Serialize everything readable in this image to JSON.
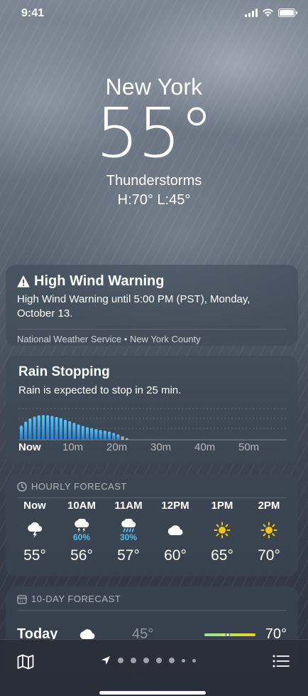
{
  "status_bar": {
    "time": "9:41"
  },
  "location": {
    "city": "New York",
    "temperature": "55°",
    "condition": "Thunderstorms",
    "high_low": "H:70°  L:45°"
  },
  "alert": {
    "title": "High Wind Warning",
    "body": "High Wind Warning until 5:00 PM (PST), Monday, October 13.",
    "source": "National Weather Service • New York County",
    "icon": "warning-icon"
  },
  "precipitation": {
    "title": "Rain Stopping",
    "description": "Rain is expected to stop in 25 min.",
    "chart_data": {
      "type": "bar",
      "x_tick_labels": [
        "Now",
        "10m",
        "20m",
        "30m",
        "40m",
        "50m"
      ],
      "values": [
        0.45,
        0.58,
        0.68,
        0.74,
        0.78,
        0.79,
        0.78,
        0.76,
        0.73,
        0.69,
        0.64,
        0.59,
        0.54,
        0.49,
        0.44,
        0.4,
        0.37,
        0.34,
        0.31,
        0.29,
        0.26,
        0.22,
        0.17,
        0.11,
        0.05
      ],
      "ylim": [
        0,
        1
      ],
      "grid": true
    }
  },
  "hourly": {
    "header": "HOURLY FORECAST",
    "hours": [
      {
        "label": "Now",
        "icon": "thunderstorm-icon",
        "precip": "",
        "temp": "55°"
      },
      {
        "label": "10AM",
        "icon": "thunderstorm-icon",
        "precip": "60%",
        "temp": "56°"
      },
      {
        "label": "11AM",
        "icon": "rain-icon",
        "precip": "30%",
        "temp": "57°"
      },
      {
        "label": "12PM",
        "icon": "cloud-icon",
        "precip": "",
        "temp": "60°"
      },
      {
        "label": "1PM",
        "icon": "sun-icon",
        "precip": "",
        "temp": "65°"
      },
      {
        "label": "2PM",
        "icon": "sun-icon",
        "precip": "",
        "temp": "70°"
      }
    ]
  },
  "ten_day": {
    "header": "10-DAY FORECAST",
    "today": {
      "day": "Today",
      "icon": "cloud-icon",
      "low": "45°",
      "high": "70°",
      "range_bar": "temperature-range-bar"
    }
  },
  "toolbar": {
    "map_icon": "map-icon",
    "location_icon": "location-arrow-icon",
    "list_icon": "list-icon"
  },
  "colors": {
    "precip_accent": "#4dc0f2",
    "sun": "#f4c41c",
    "rain_bar_top": "#58c8ff",
    "rain_bar_bottom": "#1e7fd4"
  }
}
